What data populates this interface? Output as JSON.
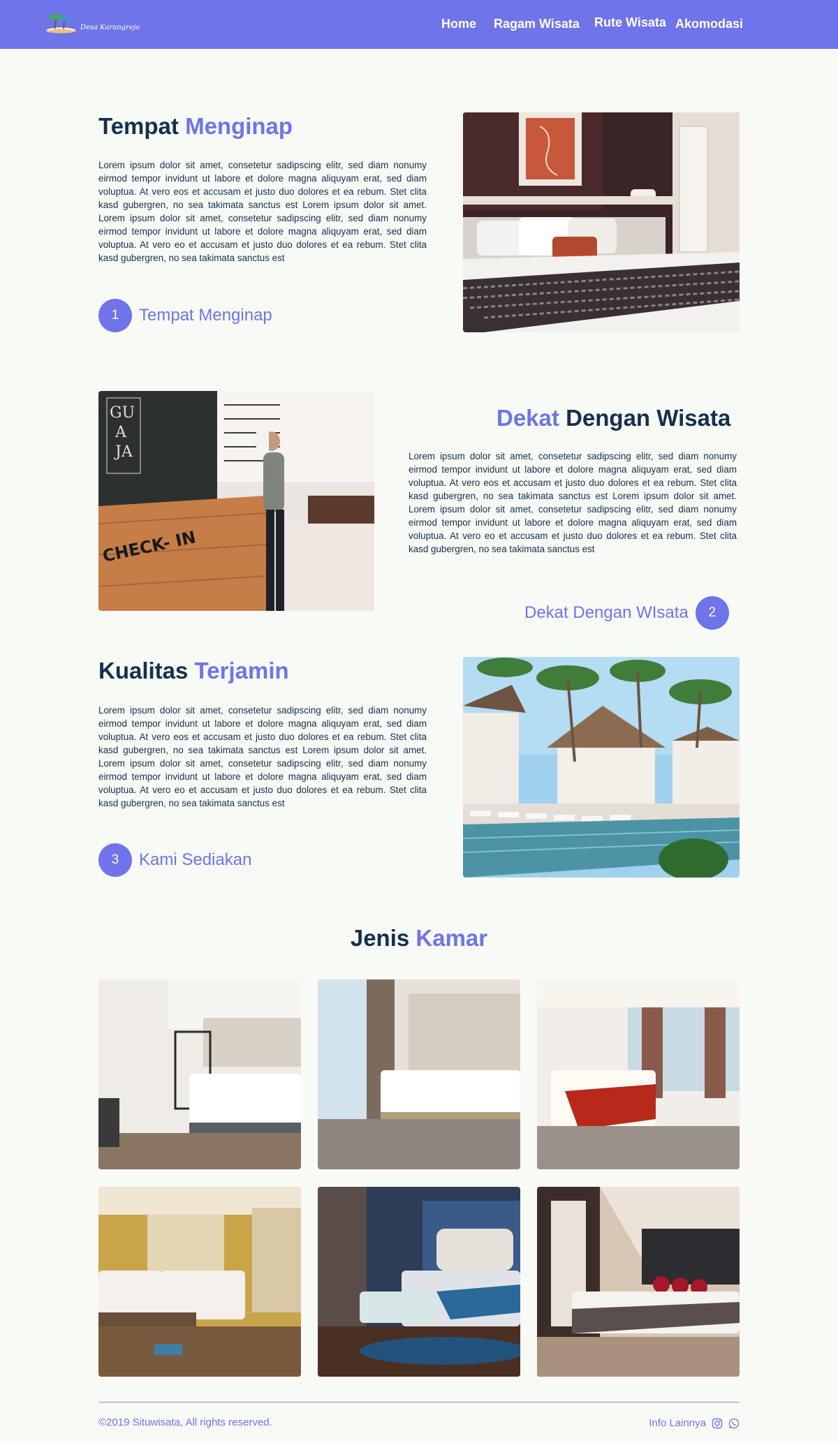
{
  "header": {
    "logo_text": "Desa Karangrejo",
    "nav": [
      {
        "label": "Home"
      },
      {
        "label": "Ragam Wisata"
      },
      {
        "label": "Rute Wisata"
      },
      {
        "label": "Akomodasi"
      }
    ]
  },
  "lorem": "Lorem ipsum dolor sit amet, consetetur sadipscing elitr, sed diam nonumy eirmod tempor invidunt ut labore et dolore magna aliquyam erat, sed diam voluptua. At vero eos et accusam et justo duo dolores et ea rebum. Stet clita kasd gubergren, no sea takimata sanctus est Lorem ipsum dolor sit amet. Lorem ipsum dolor sit amet, consetetur sadipscing elitr, sed diam nonumy eirmod tempor invidunt ut labore et dolore magna aliquyam erat, sed diam voluptua. At vero eo et accusam et justo duo dolores et ea rebum. Stet clita kasd gubergren, no sea takimata sanctus est",
  "sections": [
    {
      "title_plain": "Tempat",
      "title_accent": "Menginap",
      "badge_number": "1",
      "badge_label": "Tempat Menginap",
      "image": "hotel bedroom with patterned runner"
    },
    {
      "title_accent": "Dekat",
      "title_plain": "Dengan Wisata",
      "badge_number": "2",
      "badge_label": "Dekat Dengan WIsata",
      "image": "man at check-in desk"
    },
    {
      "title_plain": "Kualitas",
      "title_accent": "Terjamin",
      "badge_number": "3",
      "badge_label": "Kami Sediakan",
      "image": "villa with swimming pool and palm trees"
    }
  ],
  "rooms": {
    "title_plain": "Jenis",
    "title_accent": "Kamar"
  },
  "footer": {
    "copyright": "©2019 Situwisata, All rights reserved.",
    "info": "Info Lainnya"
  },
  "colors": {
    "primary": "#6f74ea",
    "navy": "#14304d",
    "background": "#f7faf5"
  }
}
